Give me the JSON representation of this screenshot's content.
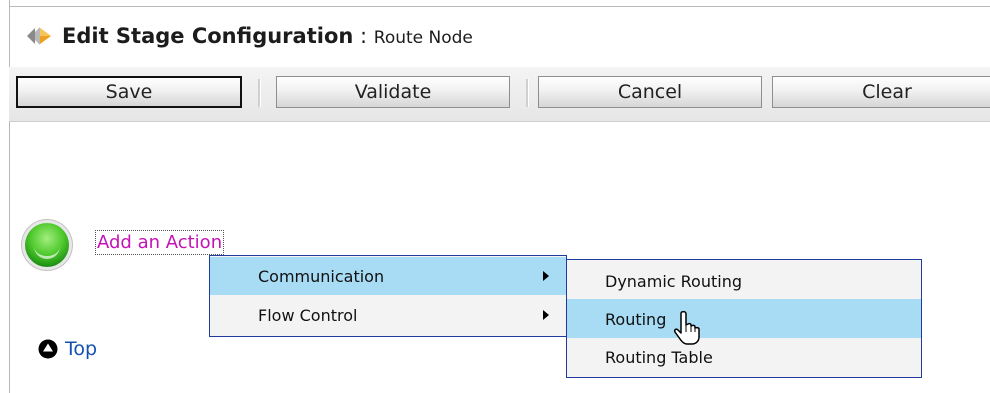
{
  "header": {
    "icon": "stage-config-icon",
    "title": "Edit Stage Configuration",
    "separator": " : ",
    "subtitle": "Route Node"
  },
  "toolbar": {
    "save_label": "Save",
    "validate_label": "Validate",
    "cancel_label": "Cancel",
    "clear_label": "Clear"
  },
  "content": {
    "add_action_label": "Add an Action",
    "top_link_label": "Top"
  },
  "action_menu": {
    "items": [
      {
        "label": "Communication",
        "highlighted": true,
        "has_submenu": true
      },
      {
        "label": "Flow Control",
        "highlighted": false,
        "has_submenu": true
      }
    ]
  },
  "communication_submenu": {
    "items": [
      {
        "label": "Dynamic Routing",
        "highlighted": false
      },
      {
        "label": "Routing",
        "highlighted": true
      },
      {
        "label": "Routing Table",
        "highlighted": false
      }
    ]
  },
  "colors": {
    "highlight": "#a7dcf4",
    "menu_border": "#203b9c",
    "link_magenta": "#c412b6",
    "link_blue": "#1450b3"
  }
}
